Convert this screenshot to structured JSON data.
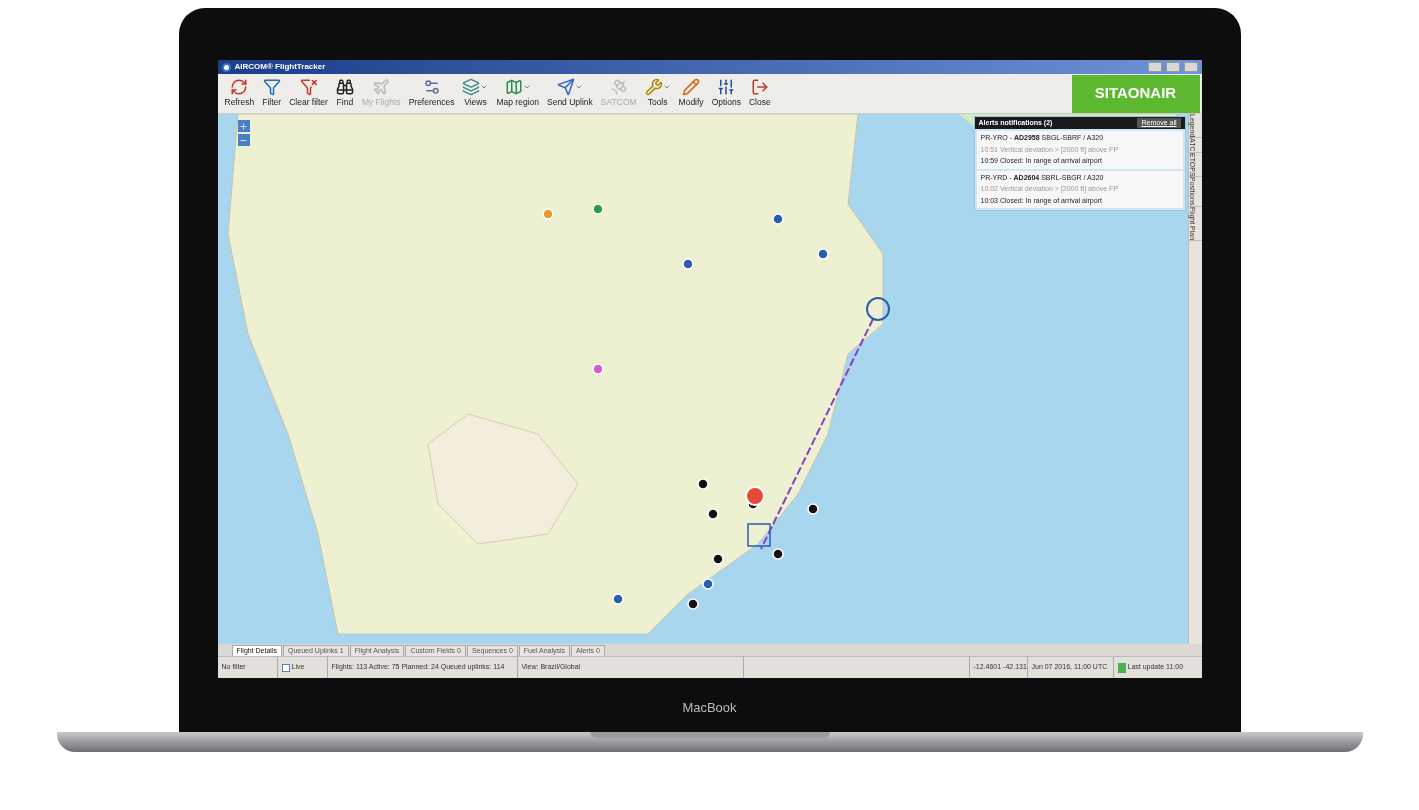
{
  "window": {
    "title": "AIRCOM® FlightTracker"
  },
  "toolbar": [
    {
      "kind": "refresh",
      "label": "Refresh",
      "disabled": false,
      "dropdown": false
    },
    {
      "kind": "filter",
      "label": "Filter",
      "disabled": false,
      "dropdown": false
    },
    {
      "kind": "clear-filter",
      "label": "Clear filter",
      "disabled": false,
      "dropdown": false
    },
    {
      "kind": "find",
      "label": "Find",
      "disabled": false,
      "dropdown": false
    },
    {
      "kind": "my-flights",
      "label": "My Flights",
      "disabled": true,
      "dropdown": false
    },
    {
      "kind": "preferences",
      "label": "Preferences",
      "disabled": false,
      "dropdown": false
    },
    {
      "kind": "views",
      "label": "Views",
      "disabled": false,
      "dropdown": true
    },
    {
      "kind": "map-region",
      "label": "Map region",
      "disabled": false,
      "dropdown": true
    },
    {
      "kind": "send-uplink",
      "label": "Send Uplink",
      "disabled": false,
      "dropdown": true
    },
    {
      "kind": "satcom",
      "label": "SATCOM",
      "disabled": true,
      "dropdown": false
    },
    {
      "kind": "tools",
      "label": "Tools",
      "disabled": false,
      "dropdown": true
    },
    {
      "kind": "modify",
      "label": "Modify",
      "disabled": false,
      "dropdown": false
    },
    {
      "kind": "options",
      "label": "Options",
      "disabled": false,
      "dropdown": false
    },
    {
      "kind": "close",
      "label": "Close",
      "disabled": false,
      "dropdown": false
    }
  ],
  "brand": "SITAONAIR",
  "alerts": {
    "title": "Alerts notifications (2)",
    "action": "Remove all",
    "items": [
      {
        "flight": "PR-YRO - **AD2958** SBGL-SBRF / A320",
        "deviation": "10:51 Vertical deviation > [2000 ft] above FP",
        "closed": "10:59 Closed: In range of arrival airport"
      },
      {
        "flight": "PR-YRD - **AD2604** SBRL-SBGR / A320",
        "deviation": "10:02 Vertical deviation > [2000 ft] above FP",
        "closed": "10:03 Closed: In range of arrival airport"
      }
    ]
  },
  "side_tabs": [
    "Legend",
    "ATC",
    "ETOPS",
    "Positions",
    "Flight Plan"
  ],
  "bottom_tabs": [
    {
      "label": "Flight Details",
      "selected": true
    },
    {
      "label": "Queued Uplinks 1",
      "selected": false
    },
    {
      "label": "Flight Analysis",
      "selected": false
    },
    {
      "label": "Custom Fields 0",
      "selected": false
    },
    {
      "label": "Sequences 0",
      "selected": false
    },
    {
      "label": "Fuel Analysis",
      "selected": false
    },
    {
      "label": "Alerts 0",
      "selected": false
    }
  ],
  "status_bar": {
    "filter": "No filter",
    "live": {
      "label": "Live",
      "checked": false
    },
    "counts": "Flights: 113  Active: 75  Planned: 24  Queued uplinks: 114",
    "view": "View: Brazil/Global",
    "coords": "-12.4601 -42.131",
    "date": "Jun 07 2016, 11:00 UTC",
    "update": {
      "label": "Last update 11:00",
      "ok": true
    }
  },
  "device_label": "MacBook"
}
